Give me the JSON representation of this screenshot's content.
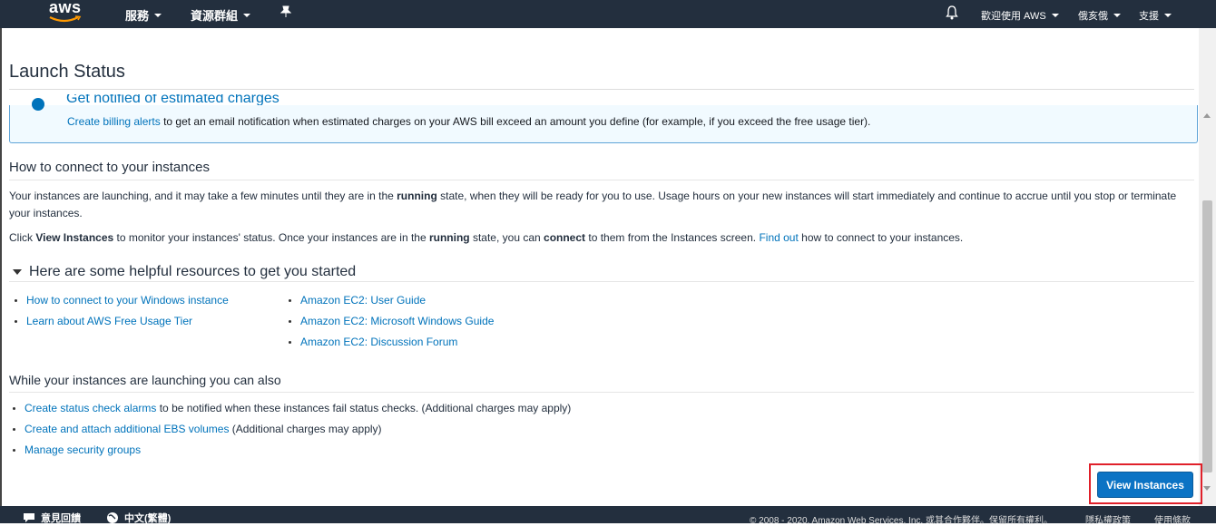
{
  "topnav": {
    "logo_text": "aws",
    "services_label": "服務",
    "resource_groups_label": "資源群組",
    "pin_icon": "pin-icon",
    "bell_icon": "bell-icon",
    "welcome_label": "歡迎使用 AWS",
    "region_label": "俄亥俄",
    "support_label": "支援"
  },
  "page": {
    "title": "Launch Status"
  },
  "info": {
    "heading": "Get notified of estimated charges",
    "link": "Create billing alerts",
    "text": "to get an email notification when estimated charges on your AWS bill exceed an amount you define (for example, if you exceed the free usage tier)."
  },
  "connect": {
    "heading": "How to connect to your instances",
    "p1_a": "Your instances are launching, and it may take a few minutes until they are in the ",
    "p1_b": "running",
    "p1_c": " state, when they will be ready for you to use. Usage hours on your new instances will start immediately and continue to accrue until you stop or terminate your instances.",
    "p2_a": "Click ",
    "p2_b": "View Instances",
    "p2_c": " to monitor your instances' status. Once your instances are in the ",
    "p2_d": "running",
    "p2_e": " state, you can ",
    "p2_f": "connect",
    "p2_g": " to them from the Instances screen. ",
    "p2_link": "Find out",
    "p2_h": " how to connect to your instances."
  },
  "resources": {
    "heading": "Here are some helpful resources to get you started",
    "col1": [
      "How to connect to your Windows instance",
      "Learn about AWS Free Usage Tier"
    ],
    "col2": [
      "Amazon EC2: User Guide",
      "Amazon EC2: Microsoft Windows Guide",
      "Amazon EC2: Discussion Forum"
    ]
  },
  "also": {
    "heading": "While your instances are launching you can also",
    "item1_link": "Create status check alarms",
    "item1_text": " to be notified when these instances fail status checks. (Additional charges may apply)",
    "item2_link": "Create and attach additional EBS volumes",
    "item2_text": " (Additional charges may apply)",
    "item3_link": "Manage security groups"
  },
  "actions": {
    "view_instances": "View Instances"
  },
  "footer": {
    "feedback": "意見回饋",
    "language": "中文(繁體)",
    "copyright": "© 2008 - 2020, Amazon Web Services, Inc. 或其合作夥伴。保留所有權利。",
    "privacy": "隱私權政策",
    "terms": "使用條款"
  },
  "colors": {
    "navbar": "#232f3e",
    "link": "#0073bb",
    "primary_button": "#0b73c4",
    "highlight": "#e0202a"
  }
}
